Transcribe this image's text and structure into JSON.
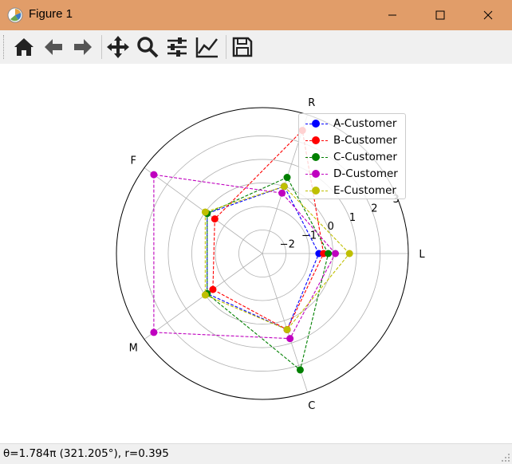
{
  "window": {
    "title": "Figure 1"
  },
  "toolbar": {
    "buttons": [
      {
        "name": "home",
        "icon": "home-icon"
      },
      {
        "name": "back",
        "icon": "arrow-left-icon"
      },
      {
        "name": "forward",
        "icon": "arrow-right-icon"
      },
      {
        "name": "pan",
        "icon": "move-icon"
      },
      {
        "name": "zoom",
        "icon": "magnifier-icon"
      },
      {
        "name": "subplots",
        "icon": "sliders-icon"
      },
      {
        "name": "edit-axis",
        "icon": "line-chart-icon"
      },
      {
        "name": "save",
        "icon": "floppy-icon"
      }
    ]
  },
  "status": {
    "text": "θ=1.784π (321.205°), r=0.395"
  },
  "chart_data": {
    "type": "radar",
    "categories": [
      "L",
      "R",
      "F",
      "M",
      "C"
    ],
    "angles_deg": [
      0,
      72,
      144,
      216,
      288
    ],
    "r_tick_labels": [
      "−2",
      "−1",
      "0",
      "1",
      "2",
      "3"
    ],
    "rlim": [
      -3,
      3.2
    ],
    "grid": true,
    "legend_position": "upper-right",
    "line_style": "dashed",
    "marker": "circle",
    "series": [
      {
        "name": "A-Customer",
        "color": "#0000ff",
        "values": [
          -0.6,
          0.0,
          -0.1,
          -0.1,
          0.4
        ]
      },
      {
        "name": "B-Customer",
        "color": "#ff0000",
        "values": [
          -0.4,
          2.5,
          -0.5,
          -0.4,
          0.4
        ]
      },
      {
        "name": "C-Customer",
        "color": "#008000",
        "values": [
          -0.2,
          0.4,
          -0.1,
          -0.1,
          2.2
        ]
      },
      {
        "name": "D-Customer",
        "color": "#bf00bf",
        "values": [
          0.1,
          -0.3,
          2.7,
          2.7,
          0.8
        ]
      },
      {
        "name": "E-Customer",
        "color": "#bfbf00",
        "values": [
          0.7,
          0.0,
          0.0,
          0.0,
          0.4
        ]
      }
    ]
  }
}
